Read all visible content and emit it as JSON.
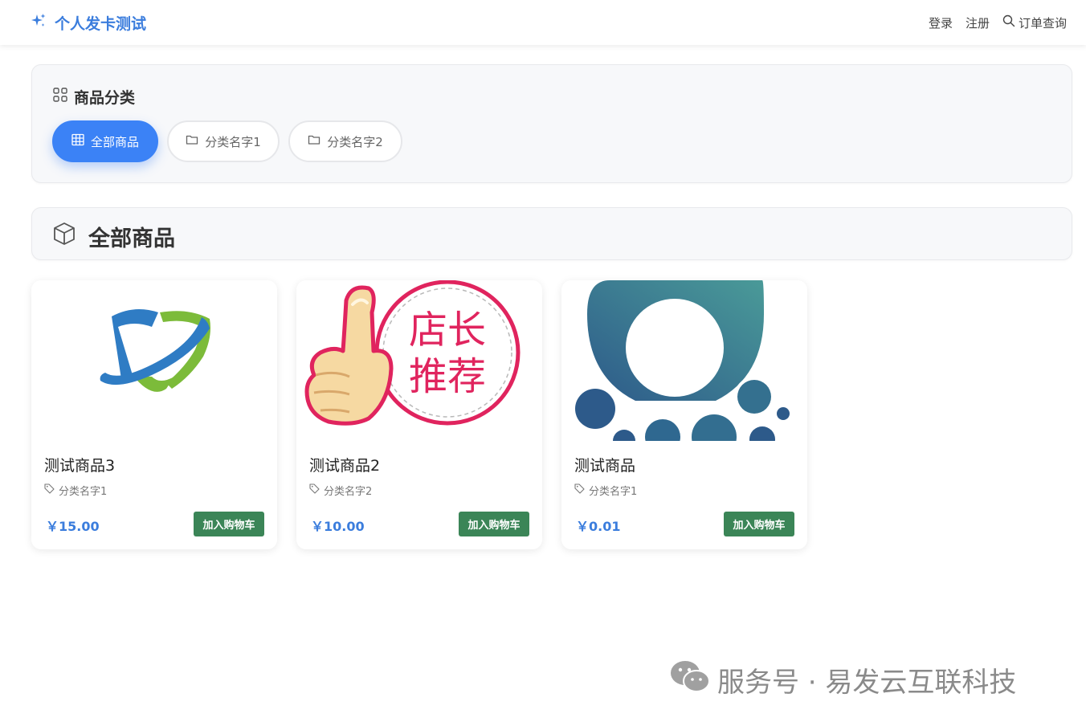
{
  "navbar": {
    "brand": "个人发卡测试",
    "links": {
      "login": "登录",
      "register": "注册",
      "order_query": "订单查询"
    },
    "accent": "#3b7ddd"
  },
  "category_panel": {
    "title": "商品分类",
    "pills": [
      {
        "label": "全部商品",
        "icon": "grid-icon",
        "active": true
      },
      {
        "label": "分类名字1",
        "icon": "folder-icon",
        "active": false
      },
      {
        "label": "分类名字2",
        "icon": "folder-icon",
        "active": false
      }
    ],
    "active_color": "#3b82f6"
  },
  "section": {
    "title": "全部商品",
    "icon": "box-icon"
  },
  "products": [
    {
      "name": "测试商品3",
      "category": "分类名字1",
      "price": "￥15.00",
      "button": "加入购物车",
      "image": "shield-logo"
    },
    {
      "name": "测试商品2",
      "category": "分类名字2",
      "price": "￥10.00",
      "button": "加入购物车",
      "image": "thumbs-up-badge",
      "badge_text": [
        "店长",
        "推荐"
      ]
    },
    {
      "name": "测试商品",
      "category": "分类名字1",
      "price": "￥0.01",
      "button": "加入购物车",
      "image": "circles-logo"
    }
  ],
  "watermark": {
    "text": "服务号 · 易发云互联科技",
    "icon": "wechat-icon"
  },
  "colors": {
    "button_green": "#3b8557",
    "price_blue": "#3b7ddd",
    "badge_red": "#e0245e"
  }
}
